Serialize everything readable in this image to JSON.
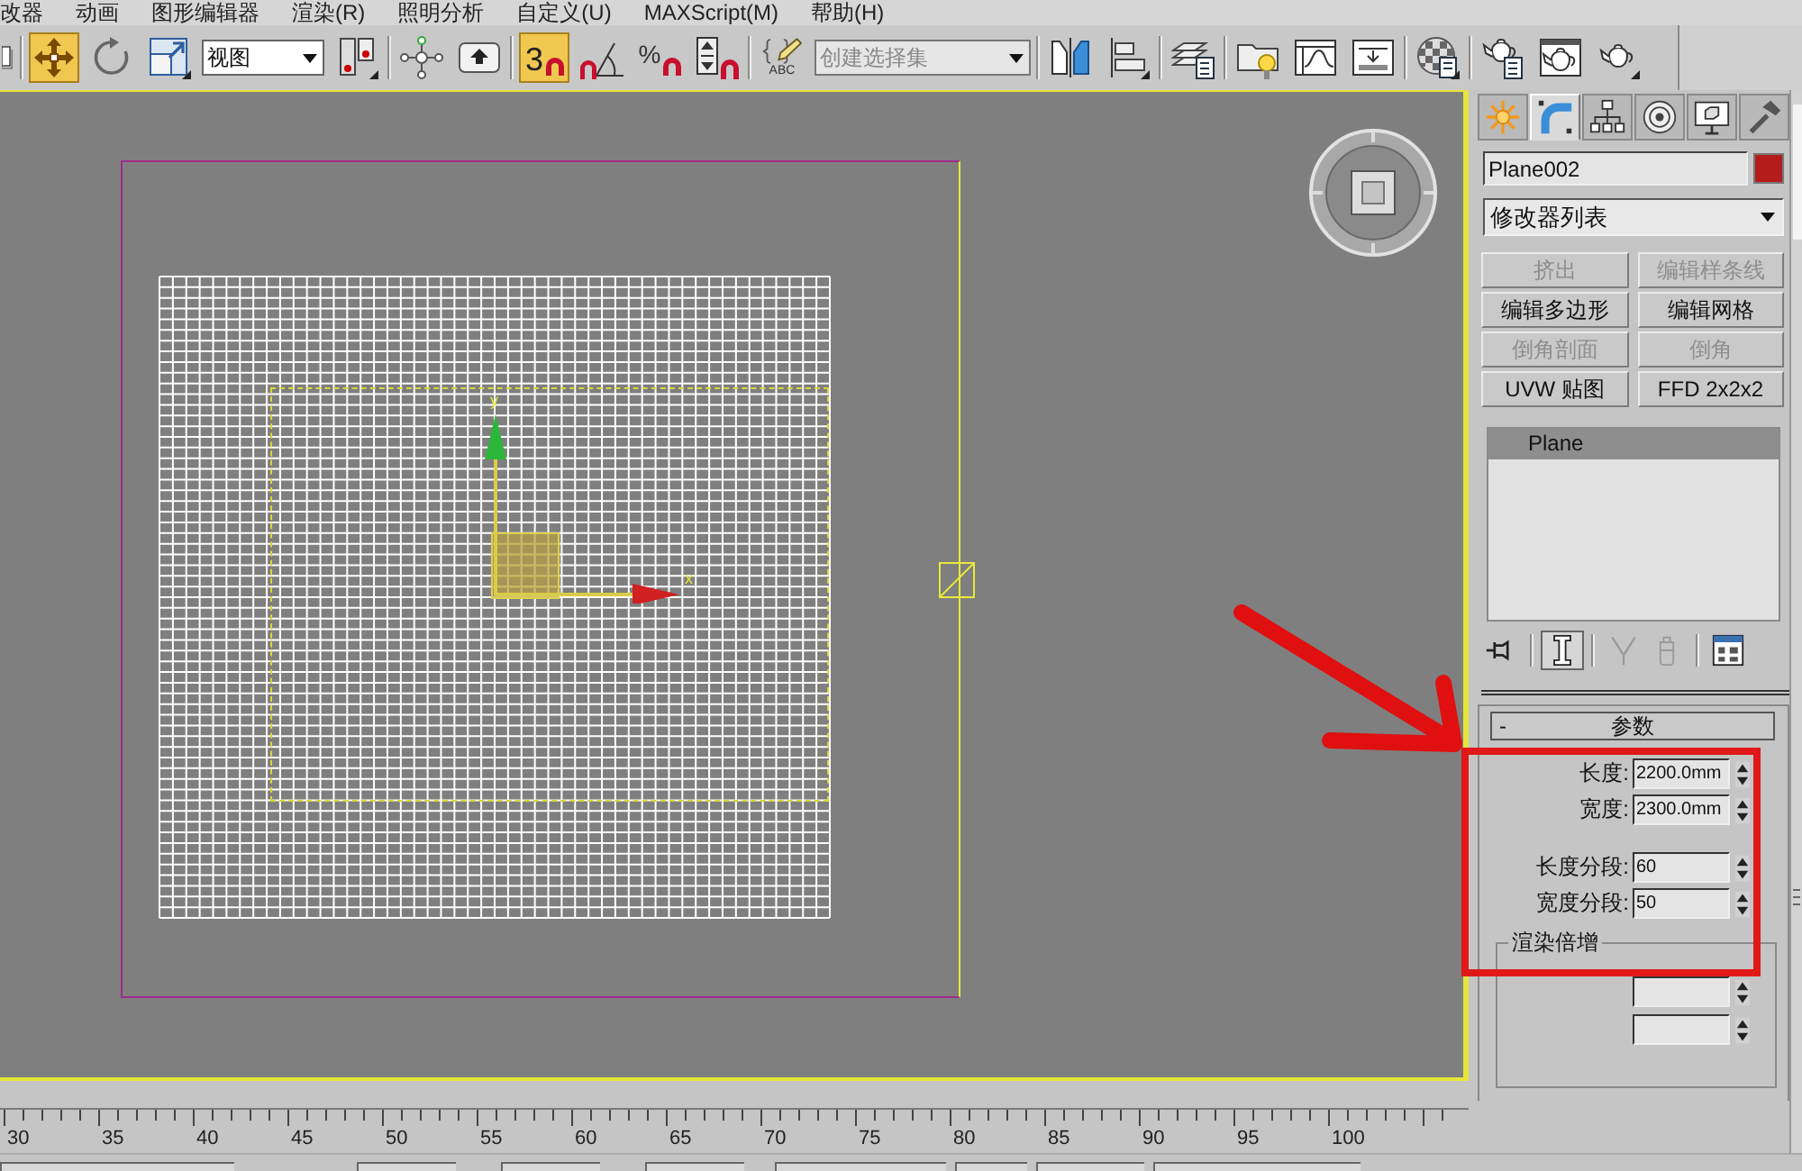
{
  "menu": [
    {
      "label": "改器"
    },
    {
      "label": "动画"
    },
    {
      "label": "图形编辑器"
    },
    {
      "label": "渲染(R)"
    },
    {
      "label": "照明分析"
    },
    {
      "label": "自定义(U)"
    },
    {
      "label": "MAXScript(M)"
    },
    {
      "label": "帮助(H)"
    }
  ],
  "toolbar": {
    "groups": [
      [
        {
          "kind": "box",
          "selected": false
        }
      ],
      [
        {
          "kind": "move",
          "selected": true
        },
        {
          "kind": "rotate",
          "selected": false
        },
        {
          "kind": "scale",
          "selected": false
        },
        {
          "kind": "dropdown",
          "value": "视图"
        },
        {
          "kind": "pivot",
          "selected": false
        }
      ],
      [
        {
          "kind": "nodes",
          "selected": false
        },
        {
          "kind": "manipulate",
          "selected": false
        }
      ],
      [
        {
          "kind": "snap",
          "label": "3",
          "selected": true
        },
        {
          "kind": "angle-snap",
          "selected": false
        },
        {
          "kind": "percent-snap",
          "label": "%",
          "selected": false
        },
        {
          "kind": "spinner-snap",
          "selected": false
        }
      ],
      [
        {
          "kind": "named-sets",
          "label": "ABC",
          "selected": false
        },
        {
          "kind": "combo",
          "placeholder": "创建选择集"
        }
      ],
      [
        {
          "kind": "mirror",
          "selected": false
        },
        {
          "kind": "align",
          "selected": false
        }
      ],
      [
        {
          "kind": "layers",
          "selected": false
        }
      ],
      [
        {
          "kind": "explorer",
          "selected": false
        },
        {
          "kind": "curves",
          "selected": false
        },
        {
          "kind": "schematic",
          "selected": false
        }
      ],
      [
        {
          "kind": "material",
          "selected": false
        }
      ],
      [
        {
          "kind": "render-setup",
          "selected": false
        },
        {
          "kind": "frame-window",
          "selected": false
        },
        {
          "kind": "render",
          "selected": false
        }
      ]
    ]
  },
  "viewport": {
    "gizmo": {
      "x_label": "x",
      "y_label": "y"
    }
  },
  "timeline": {
    "labels": [
      "30",
      "35",
      "40",
      "45",
      "50",
      "55",
      "60",
      "65",
      "70",
      "75",
      "80",
      "85",
      "90",
      "95",
      "100"
    ]
  },
  "command_panel": {
    "tabs": [
      {
        "kind": "create",
        "selected": false
      },
      {
        "kind": "modify",
        "selected": true
      },
      {
        "kind": "hierarchy",
        "selected": false
      },
      {
        "kind": "motion",
        "selected": false
      },
      {
        "kind": "display",
        "selected": false
      },
      {
        "kind": "utilities",
        "selected": false
      }
    ],
    "object_name": "Plane002",
    "modifier_list": "修改器列表",
    "modifier_buttons": [
      {
        "label": "挤出",
        "disabled": true
      },
      {
        "label": "编辑样条线",
        "disabled": true
      },
      {
        "label": "编辑多边形",
        "disabled": false
      },
      {
        "label": "编辑网格",
        "disabled": false
      },
      {
        "label": "倒角剖面",
        "disabled": true
      },
      {
        "label": "倒角",
        "disabled": true
      },
      {
        "label": "UVW 贴图",
        "disabled": false
      },
      {
        "label": "FFD 2x2x2",
        "disabled": false
      }
    ],
    "stack": [
      {
        "label": "Plane",
        "selected": true
      }
    ],
    "stack_tools": [
      {
        "kind": "pin",
        "selected": false,
        "disabled": false
      },
      {
        "kind": "end-result",
        "selected": true,
        "disabled": false
      },
      {
        "kind": "unique",
        "selected": false,
        "disabled": true
      },
      {
        "kind": "remove",
        "selected": false,
        "disabled": true
      },
      {
        "kind": "configure",
        "selected": false,
        "disabled": false
      }
    ],
    "rollout": {
      "toggle": "-",
      "title": "参数",
      "field_groups": [
        [
          {
            "label": "长度:",
            "value": "2200.0mm"
          },
          {
            "label": "宽度:",
            "value": "2300.0mm"
          }
        ],
        [
          {
            "label": "长度分段:",
            "value": "60"
          },
          {
            "label": "宽度分段:",
            "value": "50"
          }
        ]
      ],
      "group_title": "渲染倍增"
    }
  }
}
